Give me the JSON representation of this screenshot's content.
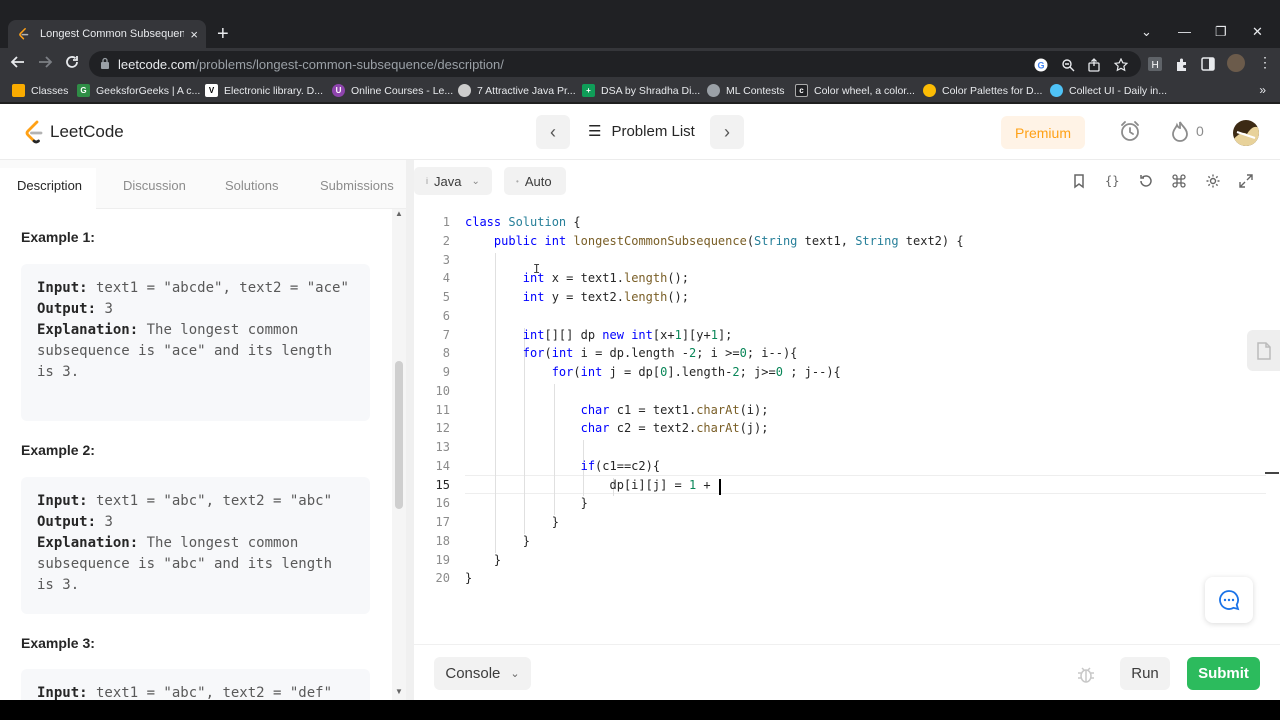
{
  "browser": {
    "tab_title": "Longest Common Subsequence",
    "tab_close": "×",
    "new_tab": "+",
    "url_domain": "leetcode.com",
    "url_path": "/problems/longest-common-subsequence/description/",
    "window_controls": [
      "⌄",
      "—",
      "❐",
      "✕"
    ],
    "bookmarks": [
      {
        "label": "Classes",
        "color": "#f9ab00",
        "icon": "folder-icon"
      },
      {
        "label": "GeeksforGeeks | A c...",
        "color": "#2f8d46",
        "icon": "gfg-icon"
      },
      {
        "label": "Electronic library. D...",
        "color": "#ffffff",
        "icon": "library-icon"
      },
      {
        "label": "Online Courses - Le...",
        "color": "#8e44ad",
        "icon": "udemy-icon"
      },
      {
        "label": "7 Attractive Java Pr...",
        "color": "#cccccc",
        "icon": "java-icon"
      },
      {
        "label": "DSA by Shradha Di...",
        "color": "#0f9d58",
        "icon": "sheets-icon"
      },
      {
        "label": "ML Contests",
        "color": "#9aa0a6",
        "icon": "contest-icon"
      },
      {
        "label": "Color wheel, a color...",
        "color": "#202124",
        "icon": "adobe-icon"
      },
      {
        "label": "Color Palettes for D...",
        "color": "#fbbc04",
        "icon": "palette-icon"
      },
      {
        "label": "Collect UI - Daily in...",
        "color": "#4fc3f7",
        "icon": "collectui-icon"
      }
    ],
    "bookmarks_more": "»"
  },
  "header": {
    "logo_text": "LeetCode",
    "problem_list": "Problem List",
    "premium": "Premium",
    "streak_count": "0",
    "prev_arrow": "‹",
    "next_arrow": "›"
  },
  "left_tabs": [
    "Description",
    "Discussion",
    "Solutions",
    "Submissions"
  ],
  "examples": [
    {
      "heading": "Example 1:",
      "input_label": "Input:",
      "input": " text1 = \"abcde\", text2 = \"ace\"",
      "output_label": "Output:",
      "output": " 3",
      "explanation_label": "Explanation:",
      "explanation": " The longest common subsequence is \"ace\" and its length is 3."
    },
    {
      "heading": "Example 2:",
      "input_label": "Input:",
      "input": " text1 = \"abc\", text2 = \"abc\"",
      "output_label": "Output:",
      "output": " 3",
      "explanation_label": "Explanation:",
      "explanation": " The longest common subsequence is \"abc\" and its length is 3."
    },
    {
      "heading": "Example 3:",
      "input_label": "Input:",
      "input": " text1 = \"abc\", text2 = \"def\""
    }
  ],
  "editor": {
    "language": "Java",
    "mode": "Auto",
    "current_line": 15,
    "lines": [
      "class Solution {",
      "    public int longestCommonSubsequence(String text1, String text2) {",
      "",
      "        int x = text1.length();",
      "        int y = text2.length();",
      "",
      "        int[][] dp new int[x+1][y+1];",
      "        for(int i = dp.length -2; i >=0; i--){",
      "            for(int j = dp[0].length-2; j>=0 ; j--){",
      "",
      "                char c1 = text1.charAt(i);",
      "                char c2 = text2.charAt(j);",
      "",
      "                if(c1==c2){",
      "                    dp[i][j] = 1 + ",
      "                }",
      "            }",
      "        }",
      "    }",
      "}"
    ]
  },
  "bottom": {
    "console": "Console",
    "run": "Run",
    "submit": "Submit"
  }
}
